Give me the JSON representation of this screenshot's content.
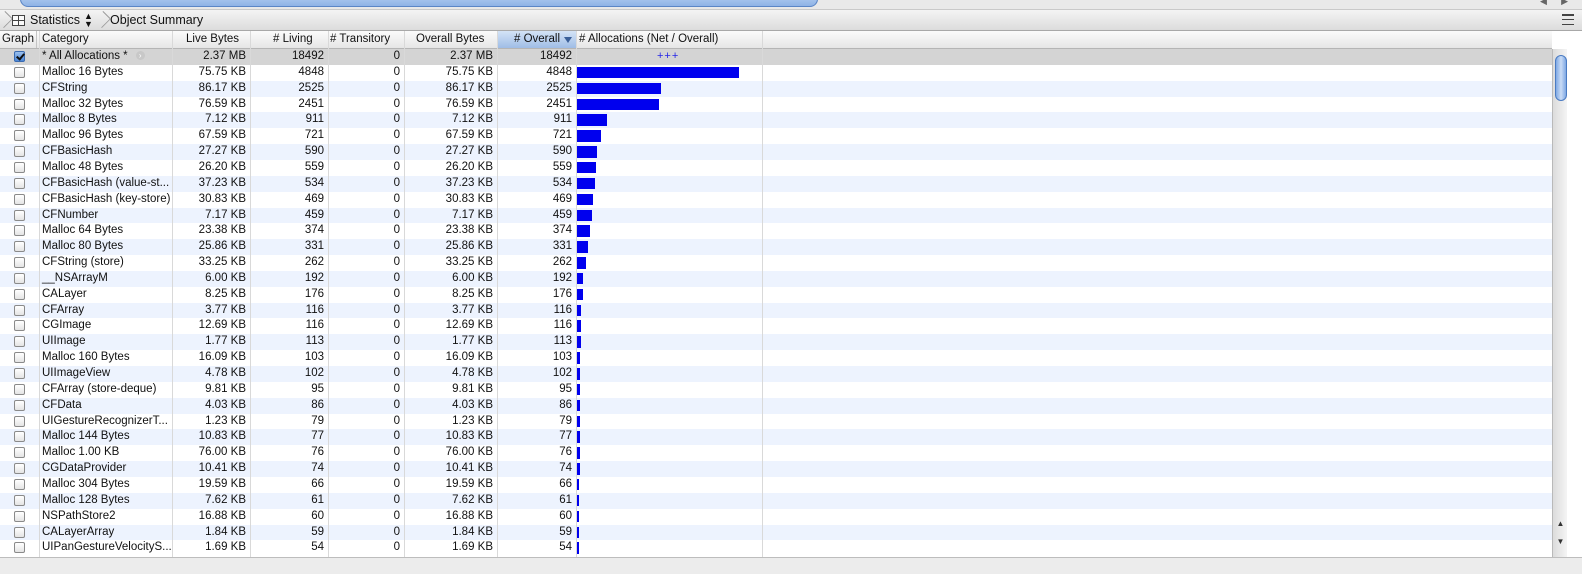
{
  "jumpbar": {
    "instrument_label": "Statistics",
    "view_label": "Object Summary"
  },
  "columns": {
    "graph": "Graph",
    "category": "Category",
    "live_bytes": "Live Bytes",
    "living": "# Living",
    "transitory": "# Transitory",
    "overall_bytes": "Overall Bytes",
    "overall": "# Overall",
    "allocations": "# Allocations (Net / Overall)"
  },
  "sorted_column": "overall",
  "summary_row": {
    "category": "* All Allocations *",
    "live_bytes": "2.37 MB",
    "living": "18492",
    "transitory": "0",
    "overall_bytes": "2.37 MB",
    "overall": "18492",
    "bar_text": "+++",
    "checked": true
  },
  "rows": [
    {
      "category": "Malloc 16 Bytes",
      "live_bytes": "75.75 KB",
      "living": "4848",
      "transitory": "0",
      "overall_bytes": "75.75 KB",
      "overall": "4848",
      "count": 4848
    },
    {
      "category": "CFString",
      "live_bytes": "86.17 KB",
      "living": "2525",
      "transitory": "0",
      "overall_bytes": "86.17 KB",
      "overall": "2525",
      "count": 2525
    },
    {
      "category": "Malloc 32 Bytes",
      "live_bytes": "76.59 KB",
      "living": "2451",
      "transitory": "0",
      "overall_bytes": "76.59 KB",
      "overall": "2451",
      "count": 2451
    },
    {
      "category": "Malloc 8 Bytes",
      "live_bytes": "7.12 KB",
      "living": "911",
      "transitory": "0",
      "overall_bytes": "7.12 KB",
      "overall": "911",
      "count": 911
    },
    {
      "category": "Malloc 96 Bytes",
      "live_bytes": "67.59 KB",
      "living": "721",
      "transitory": "0",
      "overall_bytes": "67.59 KB",
      "overall": "721",
      "count": 721
    },
    {
      "category": "CFBasicHash",
      "live_bytes": "27.27 KB",
      "living": "590",
      "transitory": "0",
      "overall_bytes": "27.27 KB",
      "overall": "590",
      "count": 590
    },
    {
      "category": "Malloc 48 Bytes",
      "live_bytes": "26.20 KB",
      "living": "559",
      "transitory": "0",
      "overall_bytes": "26.20 KB",
      "overall": "559",
      "count": 559
    },
    {
      "category": "CFBasicHash (value-st...",
      "live_bytes": "37.23 KB",
      "living": "534",
      "transitory": "0",
      "overall_bytes": "37.23 KB",
      "overall": "534",
      "count": 534
    },
    {
      "category": "CFBasicHash (key-store)",
      "live_bytes": "30.83 KB",
      "living": "469",
      "transitory": "0",
      "overall_bytes": "30.83 KB",
      "overall": "469",
      "count": 469
    },
    {
      "category": "CFNumber",
      "live_bytes": "7.17 KB",
      "living": "459",
      "transitory": "0",
      "overall_bytes": "7.17 KB",
      "overall": "459",
      "count": 459
    },
    {
      "category": "Malloc 64 Bytes",
      "live_bytes": "23.38 KB",
      "living": "374",
      "transitory": "0",
      "overall_bytes": "23.38 KB",
      "overall": "374",
      "count": 374
    },
    {
      "category": "Malloc 80 Bytes",
      "live_bytes": "25.86 KB",
      "living": "331",
      "transitory": "0",
      "overall_bytes": "25.86 KB",
      "overall": "331",
      "count": 331
    },
    {
      "category": "CFString (store)",
      "live_bytes": "33.25 KB",
      "living": "262",
      "transitory": "0",
      "overall_bytes": "33.25 KB",
      "overall": "262",
      "count": 262
    },
    {
      "category": "__NSArrayM",
      "live_bytes": "6.00 KB",
      "living": "192",
      "transitory": "0",
      "overall_bytes": "6.00 KB",
      "overall": "192",
      "count": 192
    },
    {
      "category": "CALayer",
      "live_bytes": "8.25 KB",
      "living": "176",
      "transitory": "0",
      "overall_bytes": "8.25 KB",
      "overall": "176",
      "count": 176
    },
    {
      "category": "CFArray",
      "live_bytes": "3.77 KB",
      "living": "116",
      "transitory": "0",
      "overall_bytes": "3.77 KB",
      "overall": "116",
      "count": 116
    },
    {
      "category": "CGImage",
      "live_bytes": "12.69 KB",
      "living": "116",
      "transitory": "0",
      "overall_bytes": "12.69 KB",
      "overall": "116",
      "count": 116
    },
    {
      "category": "UIImage",
      "live_bytes": "1.77 KB",
      "living": "113",
      "transitory": "0",
      "overall_bytes": "1.77 KB",
      "overall": "113",
      "count": 113
    },
    {
      "category": "Malloc 160 Bytes",
      "live_bytes": "16.09 KB",
      "living": "103",
      "transitory": "0",
      "overall_bytes": "16.09 KB",
      "overall": "103",
      "count": 103
    },
    {
      "category": "UIImageView",
      "live_bytes": "4.78 KB",
      "living": "102",
      "transitory": "0",
      "overall_bytes": "4.78 KB",
      "overall": "102",
      "count": 102
    },
    {
      "category": "CFArray (store-deque)",
      "live_bytes": "9.81 KB",
      "living": "95",
      "transitory": "0",
      "overall_bytes": "9.81 KB",
      "overall": "95",
      "count": 95
    },
    {
      "category": "CFData",
      "live_bytes": "4.03 KB",
      "living": "86",
      "transitory": "0",
      "overall_bytes": "4.03 KB",
      "overall": "86",
      "count": 86
    },
    {
      "category": "UIGestureRecognizerT...",
      "live_bytes": "1.23 KB",
      "living": "79",
      "transitory": "0",
      "overall_bytes": "1.23 KB",
      "overall": "79",
      "count": 79
    },
    {
      "category": "Malloc 144 Bytes",
      "live_bytes": "10.83 KB",
      "living": "77",
      "transitory": "0",
      "overall_bytes": "10.83 KB",
      "overall": "77",
      "count": 77
    },
    {
      "category": "Malloc 1.00 KB",
      "live_bytes": "76.00 KB",
      "living": "76",
      "transitory": "0",
      "overall_bytes": "76.00 KB",
      "overall": "76",
      "count": 76
    },
    {
      "category": "CGDataProvider",
      "live_bytes": "10.41 KB",
      "living": "74",
      "transitory": "0",
      "overall_bytes": "10.41 KB",
      "overall": "74",
      "count": 74
    },
    {
      "category": "Malloc 304 Bytes",
      "live_bytes": "19.59 KB",
      "living": "66",
      "transitory": "0",
      "overall_bytes": "19.59 KB",
      "overall": "66",
      "count": 66
    },
    {
      "category": "Malloc 128 Bytes",
      "live_bytes": "7.62 KB",
      "living": "61",
      "transitory": "0",
      "overall_bytes": "7.62 KB",
      "overall": "61",
      "count": 61
    },
    {
      "category": "NSPathStore2",
      "live_bytes": "16.88 KB",
      "living": "60",
      "transitory": "0",
      "overall_bytes": "16.88 KB",
      "overall": "60",
      "count": 60
    },
    {
      "category": "CALayerArray",
      "live_bytes": "1.84 KB",
      "living": "59",
      "transitory": "0",
      "overall_bytes": "1.84 KB",
      "overall": "59",
      "count": 59
    },
    {
      "category": "UIPanGestureVelocityS...",
      "live_bytes": "1.69 KB",
      "living": "54",
      "transitory": "0",
      "overall_bytes": "1.69 KB",
      "overall": "54",
      "count": 54
    }
  ],
  "bar_color": "#0000ee",
  "bar_max_count": 4848,
  "icons": {
    "view_icon": "table-grid-icon",
    "popup_icon": "up-down-arrows-icon",
    "options_icon": "list-menu-icon",
    "focus_icon": "focus-arrow-icon"
  }
}
